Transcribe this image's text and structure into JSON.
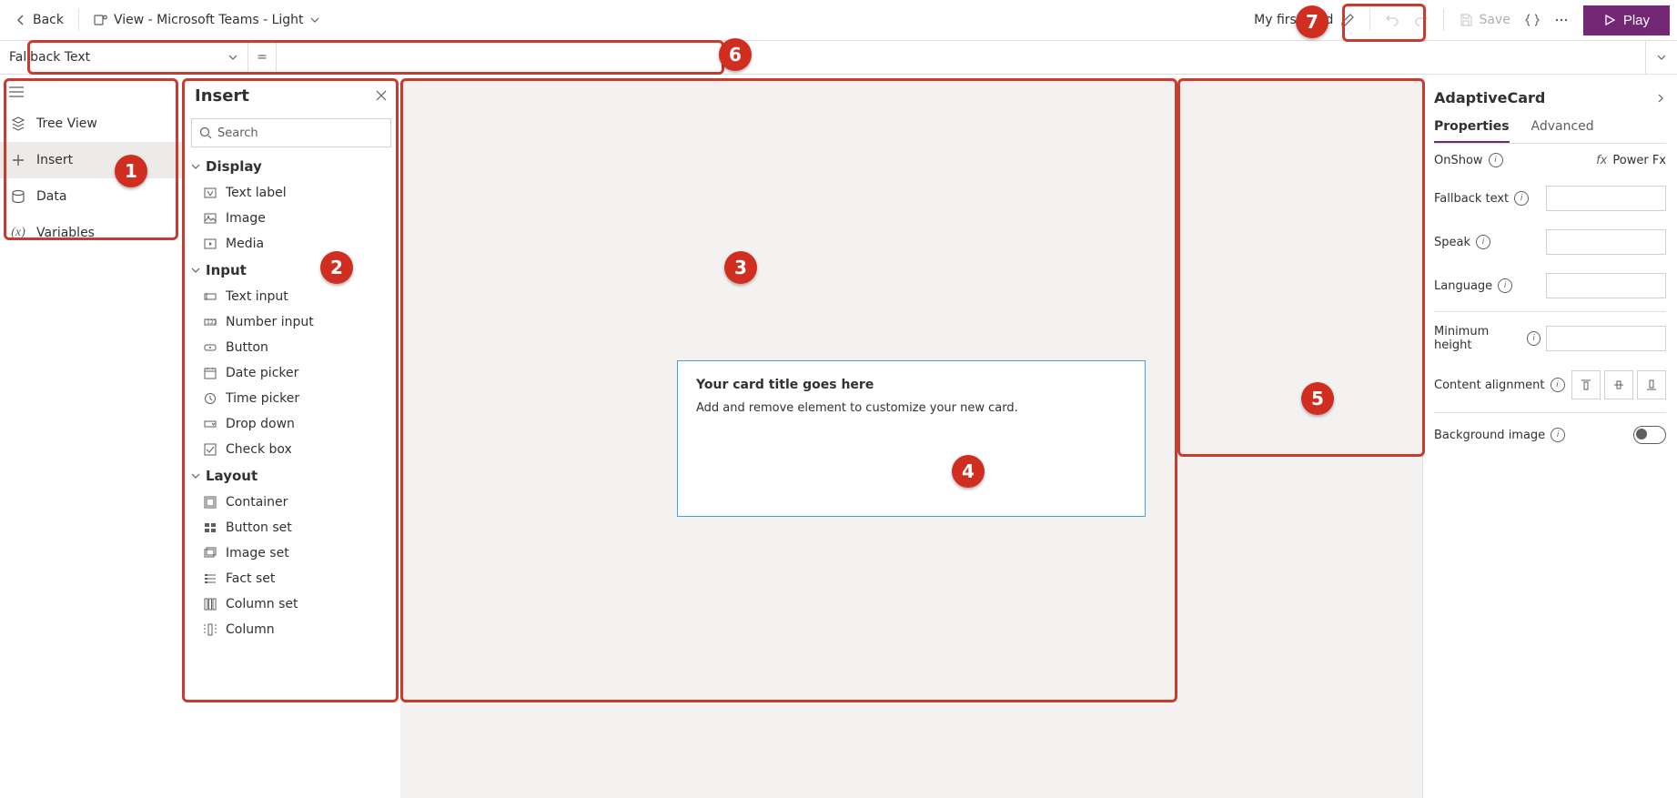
{
  "cmdbar": {
    "back_label": "Back",
    "view_label": "View - Microsoft Teams - Light",
    "card_name": "My first card",
    "save_label": "Save",
    "play_label": "Play"
  },
  "formula": {
    "property": "Fallback Text",
    "equals": "=",
    "value": ""
  },
  "nav": {
    "items": [
      {
        "label": "Tree View"
      },
      {
        "label": "Insert"
      },
      {
        "label": "Data"
      },
      {
        "label": "Variables"
      }
    ]
  },
  "insert": {
    "title": "Insert",
    "search_placeholder": "Search",
    "groups": {
      "display": {
        "title": "Display",
        "items": [
          "Text label",
          "Image",
          "Media"
        ]
      },
      "input": {
        "title": "Input",
        "items": [
          "Text input",
          "Number input",
          "Button",
          "Date picker",
          "Time picker",
          "Drop down",
          "Check box"
        ]
      },
      "layout": {
        "title": "Layout",
        "items": [
          "Container",
          "Button set",
          "Image set",
          "Fact set",
          "Column set",
          "Column"
        ]
      }
    }
  },
  "card": {
    "title": "Your card title goes here",
    "subtitle": "Add and remove element to customize your new card."
  },
  "props": {
    "title": "AdaptiveCard",
    "tabs": {
      "properties": "Properties",
      "advanced": "Advanced"
    },
    "onshow": "OnShow",
    "powerfx": "Power Fx",
    "fallback": "Fallback text",
    "speak": "Speak",
    "language": "Language",
    "minheight": "Minimum height",
    "content_align": "Content alignment",
    "bgimage": "Background image"
  },
  "callouts": [
    "1",
    "2",
    "3",
    "4",
    "5",
    "6",
    "7"
  ]
}
